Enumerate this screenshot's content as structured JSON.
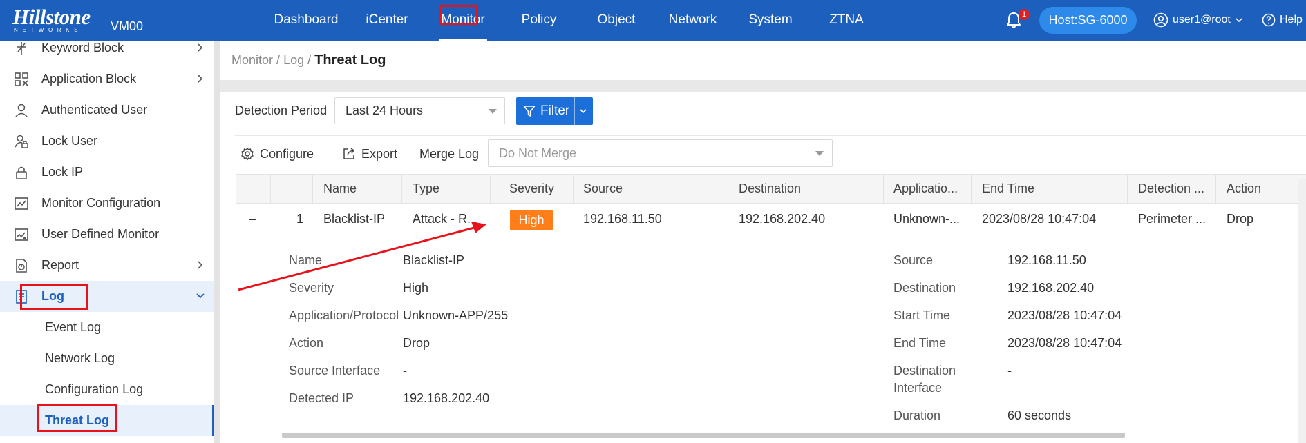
{
  "header": {
    "logo_text": "Hillstone",
    "logo_subtext": "NETWORKS",
    "device_name": "VM00",
    "nav": [
      "Dashboard",
      "iCenter",
      "Monitor",
      "Policy",
      "Object",
      "Network",
      "System",
      "ZTNA"
    ],
    "active_nav": "Monitor",
    "notification_count": "1",
    "host": "Host:SG-6000",
    "user": "user1@root",
    "help": "Help"
  },
  "sidebar": {
    "items": [
      {
        "label": "Keyword Block",
        "icon": "keyword-icon"
      },
      {
        "label": "Application Block",
        "icon": "app-grid-icon"
      },
      {
        "label": "Authenticated User",
        "icon": "user-icon"
      },
      {
        "label": "Lock User",
        "icon": "lock-user-icon"
      },
      {
        "label": "Lock IP",
        "icon": "lock-icon"
      },
      {
        "label": "Monitor Configuration",
        "icon": "chart-icon"
      },
      {
        "label": "User Defined Monitor",
        "icon": "custom-chart-icon"
      },
      {
        "label": "Report",
        "icon": "report-icon"
      },
      {
        "label": "Log",
        "icon": "log-icon"
      }
    ],
    "log_children": [
      "Event Log",
      "Network Log",
      "Configuration Log",
      "Threat Log"
    ],
    "selected": "Threat Log"
  },
  "breadcrumb": {
    "root": "Monitor",
    "parent": "Log",
    "current": "Threat Log"
  },
  "toolbar": {
    "detection_period_label": "Detection Period",
    "detection_period_value": "Last 24 Hours",
    "filter_label": "Filter",
    "configure_label": "Configure",
    "export_label": "Export",
    "merge_log_label": "Merge Log",
    "merge_log_value": "Do Not Merge"
  },
  "table": {
    "columns": [
      "Name",
      "Type",
      "Severity",
      "Source",
      "Destination",
      "Applicatio...",
      "End Time",
      "Detection ...",
      "Action"
    ],
    "row": {
      "toggle": "–",
      "index": "1",
      "name": "Blacklist-IP",
      "type": "Attack - R...",
      "severity": "High",
      "source": "192.168.11.50",
      "destination": "192.168.202.40",
      "application": "Unknown-...",
      "end_time": "2023/08/28 10:47:04",
      "detection": "Perimeter ...",
      "action": "Drop"
    },
    "detail_left": [
      {
        "key": "Name",
        "value": "Blacklist-IP"
      },
      {
        "key": "Severity",
        "value": "High"
      },
      {
        "key": "Application/Protocol",
        "value": "Unknown-APP/255"
      },
      {
        "key": "Action",
        "value": "Drop"
      },
      {
        "key": "Source Interface",
        "value": "-"
      },
      {
        "key": "Detected IP",
        "value": "192.168.202.40"
      }
    ],
    "detail_right": [
      {
        "key": "Source",
        "value": "192.168.11.50"
      },
      {
        "key": "Destination",
        "value": "192.168.202.40"
      },
      {
        "key": "Start Time",
        "value": "2023/08/28 10:47:04"
      },
      {
        "key": "End Time",
        "value": "2023/08/28 10:47:04"
      },
      {
        "key": "Destination",
        "key2": "Interface",
        "value": "-"
      },
      {
        "key": "Duration",
        "value": "60 seconds"
      }
    ]
  },
  "colors": {
    "brand_blue": "#1c5fbd",
    "severity_high": "#ff7e1a",
    "annotation_red": "#e8121a"
  }
}
